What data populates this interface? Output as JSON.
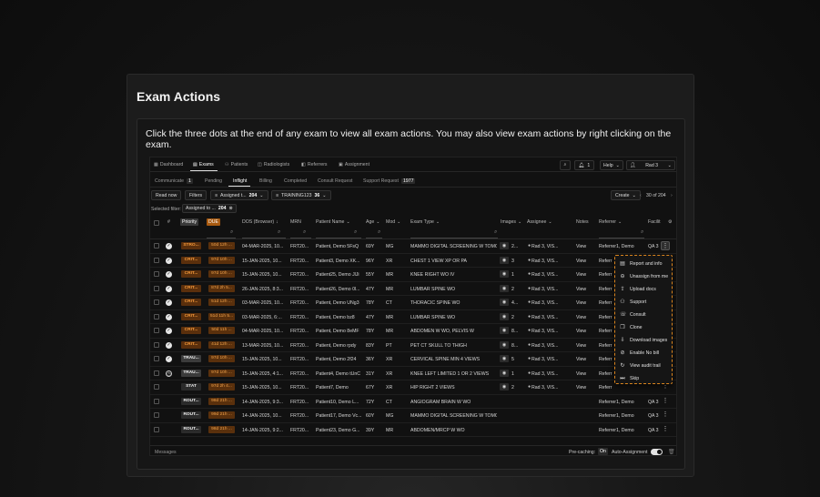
{
  "card": {
    "title": "Exam Actions",
    "description": "Click the three dots at the end of any exam to view all exam actions. You may also view exam actions by right clicking on the exam."
  },
  "nav": {
    "items": [
      {
        "label": "Dashboard",
        "icon": "grid-icon"
      },
      {
        "label": "Exams",
        "icon": "list-icon",
        "active": true
      },
      {
        "label": "Patients",
        "icon": "people-icon"
      },
      {
        "label": "Radiologists",
        "icon": "radiologist-icon"
      },
      {
        "label": "Referrers",
        "icon": "referrer-icon"
      },
      {
        "label": "Assignment",
        "icon": "assignment-icon"
      }
    ],
    "notifications": "1",
    "help": "Help",
    "user": "Rad 3"
  },
  "tabs": [
    {
      "label": "Communicate",
      "badge": "1"
    },
    {
      "label": "Pending",
      "badge": ""
    },
    {
      "label": "Inflight",
      "badge": "",
      "active": true
    },
    {
      "label": "Billing",
      "badge": ""
    },
    {
      "label": "Completed",
      "badge": ""
    },
    {
      "label": "Consult Request",
      "badge": ""
    },
    {
      "label": "Support Request",
      "badge": "1977"
    }
  ],
  "toolbar": {
    "read_now": "Read now",
    "filters": "Filters",
    "chip1_label": "Assigned t...",
    "chip1_count": "204",
    "chip2_label": "TRAINING123",
    "chip2_count": "36",
    "create": "Create",
    "pagination": "30 of 204"
  },
  "selected_filter": {
    "label": "Selected filter:",
    "chip": "Assigned to ...",
    "count": "204"
  },
  "columns": {
    "hash": "#",
    "priority": "Priority",
    "due": "DUE",
    "dos": "DOS (Browser)",
    "mrn": "MRN",
    "patient": "Patient Name",
    "age": "Age",
    "mod": "Mod",
    "exam_type": "Exam Type",
    "images": "Images",
    "assignee": "Assignee",
    "notes": "Notes",
    "referrer": "Referrer",
    "facility": "Facilit"
  },
  "rows": [
    {
      "status": "check",
      "priority": "STRO...",
      "prio_class": "crit",
      "due": "50d 12h ...",
      "dos": "04-MAR-2025, 10...",
      "mrn": "FRT20...",
      "patient": "Patient, Demo 5FsQ",
      "age": "69Y",
      "mod": "MG",
      "exam": "MAMMO DIGITAL SCREENING W TOMO",
      "images": "2...",
      "assignee": "Rad 3, VIS...",
      "notes": "View",
      "referrer": "Referrer1, Demo",
      "facility": "QA 3"
    },
    {
      "status": "check",
      "priority": "CRIT...",
      "prio_class": "crit",
      "due": "97d 10h ...",
      "dos": "15-JAN-2025, 10...",
      "mrn": "FRT20...",
      "patient": "Patient3, Demo XK...",
      "age": "96Y",
      "mod": "XR",
      "exam": "CHEST 1 VIEW XP OR PA",
      "images": "3",
      "assignee": "Rad 3, VIS...",
      "notes": "View",
      "referrer": "Referr",
      "facility": ""
    },
    {
      "status": "check",
      "priority": "CRIT...",
      "prio_class": "crit",
      "due": "97d 10h ...",
      "dos": "15-JAN-2025, 10...",
      "mrn": "FRT20...",
      "patient": "Patient25, Demo JlJi",
      "age": "55Y",
      "mod": "MR",
      "exam": "KNEE RIGHT WO IV",
      "images": "1",
      "assignee": "Rad 3, VIS...",
      "notes": "View",
      "referrer": "Referr",
      "facility": ""
    },
    {
      "status": "check",
      "priority": "CRIT...",
      "prio_class": "crit",
      "due": "87d 2h 5...",
      "dos": "26-JAN-2025, 8:3...",
      "mrn": "FRT20...",
      "patient": "Patient26, Demo 0l...",
      "age": "47Y",
      "mod": "MR",
      "exam": "LUMBAR SPINE WO",
      "images": "2",
      "assignee": "Rad 3, VIS...",
      "notes": "View",
      "referrer": "Referr",
      "facility": ""
    },
    {
      "status": "check",
      "priority": "CRIT...",
      "prio_class": "crit",
      "due": "51d 12h ...",
      "dos": "03-MAR-2025, 10...",
      "mrn": "FRT20...",
      "patient": "Patient, Demo UNg3",
      "age": "78Y",
      "mod": "CT",
      "exam": "THORACIC SPINE WO",
      "images": "4...",
      "assignee": "Rad 3, VIS...",
      "notes": "View",
      "referrer": "Referr",
      "facility": ""
    },
    {
      "status": "check",
      "priority": "CRIT...",
      "prio_class": "crit",
      "due": "51d 11h 5...",
      "dos": "03-MAR-2025, 6:...",
      "mrn": "FRT20...",
      "patient": "Patient, Demo bz8",
      "age": "47Y",
      "mod": "MR",
      "exam": "LUMBAR SPINE WO",
      "images": "2",
      "assignee": "Rad 3, VIS...",
      "notes": "View",
      "referrer": "Referr",
      "facility": ""
    },
    {
      "status": "check",
      "priority": "CRIT...",
      "prio_class": "crit",
      "due": "50d 11h ...",
      "dos": "04-MAR-2025, 10...",
      "mrn": "FRT20...",
      "patient": "Patient, Demo 8eMF",
      "age": "78Y",
      "mod": "MR",
      "exam": "ABDOMEN W WO, PELVIS W",
      "images": "8...",
      "assignee": "Rad 3, VIS...",
      "notes": "View",
      "referrer": "Referr",
      "facility": ""
    },
    {
      "status": "check",
      "priority": "CRIT...",
      "prio_class": "crit",
      "due": "41d 12h ...",
      "dos": "13-MAR-2025, 10...",
      "mrn": "FRT20...",
      "patient": "Patient, Demo rpdy",
      "age": "83Y",
      "mod": "PT",
      "exam": "PET CT SKULL TO THIGH",
      "images": "8...",
      "assignee": "Rad 3, VIS...",
      "notes": "View",
      "referrer": "Referr",
      "facility": ""
    },
    {
      "status": "check",
      "priority": "TRAU...",
      "prio_class": "trau",
      "due": "97d 10h ...",
      "dos": "15-JAN-2025, 10...",
      "mrn": "FRT20...",
      "patient": "Patient, Demo 2f24",
      "age": "36Y",
      "mod": "XR",
      "exam": "CERVICAL SPINE MIN 4 VIEWS",
      "images": "5",
      "assignee": "Rad 3, VIS...",
      "notes": "View",
      "referrer": "Referr",
      "facility": ""
    },
    {
      "status": "ring",
      "priority": "TRAU...",
      "prio_class": "trau",
      "due": "97d 10h ...",
      "dos": "15-JAN-2025, 4:1...",
      "mrn": "FRT20...",
      "patient": "Patient4, Demo tUnC",
      "age": "31Y",
      "mod": "XR",
      "exam": "KNEE LEFT LIMITED 1 OR 2 VIEWS",
      "images": "1",
      "assignee": "Rad 3, VIS...",
      "notes": "View",
      "referrer": "Referr",
      "facility": ""
    },
    {
      "status": "",
      "priority": "STAT",
      "prio_class": "stat",
      "due": "97d 2h 4...",
      "dos": "15-JAN-2025, 10...",
      "mrn": "FRT20...",
      "patient": "Patient7, Demo",
      "age": "67Y",
      "mod": "XR",
      "exam": "HIP RIGHT 2 VIEWS",
      "images": "2",
      "assignee": "Rad 3, VIS...",
      "notes": "View",
      "referrer": "Referr",
      "facility": ""
    },
    {
      "status": "",
      "priority": "ROUT...",
      "prio_class": "rout",
      "due": "98d 21h ...",
      "dos": "14-JAN-2025, 9:3...",
      "mrn": "FRT20...",
      "patient": "Patient10, Demo L...",
      "age": "72Y",
      "mod": "CT",
      "exam": "ANGIOGRAM BRAIN W WO",
      "images": "",
      "assignee": "",
      "notes": "",
      "referrer": "Referrer1, Demo",
      "facility": "QA 3"
    },
    {
      "status": "",
      "priority": "ROUT...",
      "prio_class": "rout",
      "due": "99d 21h ...",
      "dos": "14-JAN-2025, 10...",
      "mrn": "FRT20...",
      "patient": "Patient17, Demo Vc...",
      "age": "60Y",
      "mod": "MG",
      "exam": "MAMMO DIGITAL SCREENING W TOMO",
      "images": "",
      "assignee": "",
      "notes": "",
      "referrer": "Referrer1, Demo",
      "facility": "QA 3"
    },
    {
      "status": "",
      "priority": "ROUT...",
      "prio_class": "rout",
      "due": "98d 21h ...",
      "dos": "14-JAN-2025, 9:2...",
      "mrn": "FRT20...",
      "patient": "Patient23, Demo G...",
      "age": "39Y",
      "mod": "MR",
      "exam": "ABDOMEN/MRCP W WO",
      "images": "",
      "assignee": "",
      "notes": "",
      "referrer": "Referrer1, Demo",
      "facility": "QA 3"
    }
  ],
  "menu": [
    {
      "label": "Report and info",
      "icon": "report-icon"
    },
    {
      "label": "Unassign from me",
      "icon": "unassign-icon"
    },
    {
      "label": "Upload docs",
      "icon": "upload-icon"
    },
    {
      "label": "Support",
      "icon": "support-icon"
    },
    {
      "label": "Consult",
      "icon": "consult-icon"
    },
    {
      "label": "Clone",
      "icon": "clone-icon"
    },
    {
      "label": "Download images",
      "icon": "download-icon"
    },
    {
      "label": "Enable No bill",
      "icon": "nobill-icon"
    },
    {
      "label": "View audit trail",
      "icon": "audit-icon"
    },
    {
      "label": "Skip",
      "icon": "skip-icon"
    }
  ],
  "footer": {
    "messages": "Messages",
    "precaching": "Pre-caching:",
    "precaching_value": "On",
    "auto_assignment": "Auto-Assignment"
  }
}
